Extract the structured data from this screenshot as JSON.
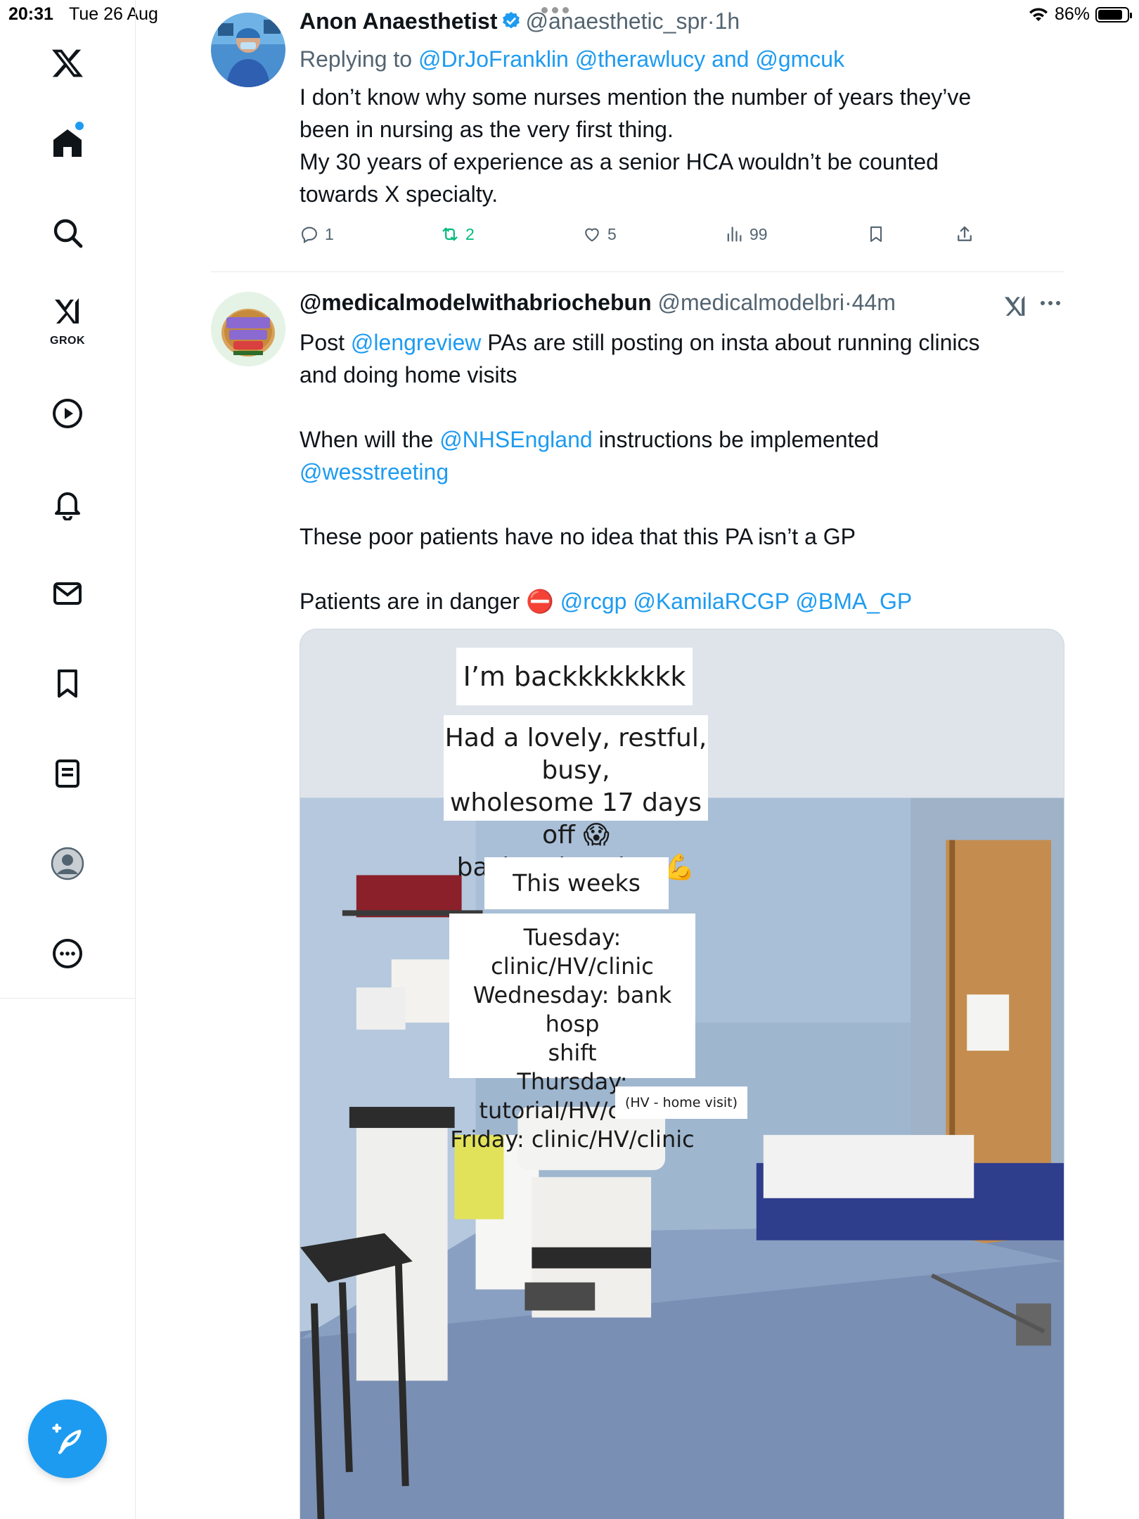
{
  "status_bar": {
    "time": "20:31",
    "date": "Tue 26 Aug",
    "battery": "86%",
    "battery_level": 0.86
  },
  "sidebar": {
    "items": [
      "x-logo",
      "home",
      "search",
      "grok",
      "videos",
      "notifications",
      "messages",
      "bookmarks",
      "lists",
      "profile",
      "more"
    ],
    "grok_label": "GROK",
    "compose": "compose"
  },
  "tweets": [
    {
      "name": "Anon Anaesthetist",
      "handle": "@anaesthetic_spr",
      "dot": "·",
      "time": "1h",
      "reply_prefix": "Replying to",
      "reply_to": [
        "@DrJoFranklin",
        "@therawlucy",
        "and",
        "@gmcuk"
      ],
      "text": [
        "I don’t know why some nurses mention the number of years they’ve",
        "been in nursing as the very first thing.",
        "My 30 years of experience as a senior HCA wouldn’t be counted",
        "towards X specialty."
      ],
      "stats": {
        "replies": "1",
        "reposts": "2",
        "likes": "5",
        "views": "99"
      }
    },
    {
      "name": "@medicalmodelwithabriochebun",
      "handle": "@medicalmodelbri",
      "dot": "·",
      "time": "44m",
      "text": {
        "l1a": "Post ",
        "l1b": "@lengreview",
        "l1c": " PAs are still posting on insta about running clinics",
        "l2": "and doing home visits",
        "l3a": "When will the ",
        "l3b": "@NHSEngland",
        "l3c": " instructions be implemented",
        "l4": "@wesstreeting",
        "l5": "These poor patients have no idea that this PA isn’t a GP",
        "l6a": "Patients are in danger ",
        "l6b": "⛔",
        "l6c": " @rcgp @KamilaRCGP @BMA_GP"
      },
      "image_captions": {
        "c1": "I’m backkkkkkkk 💅☀️💺",
        "c2a": "Had a lovely, restful, busy,",
        "c2b": "wholesome 17 days off 😱",
        "c2c": "back to it today 💪",
        "c3": "This weeks agenda:",
        "c4a": "Tuesday: clinic/HV/clinic",
        "c4b": "Wednesday: bank hosp",
        "c4c": "shift",
        "c4d": "Thursday: tutorial/HV/clinic",
        "c4e": "Friday: clinic/HV/clinic",
        "c5": "(HV - home visit)"
      }
    }
  ],
  "colors": {
    "accent": "#1d9bf0",
    "repost": "#00ba7c",
    "muted": "#536471",
    "text": "#0f1419"
  }
}
